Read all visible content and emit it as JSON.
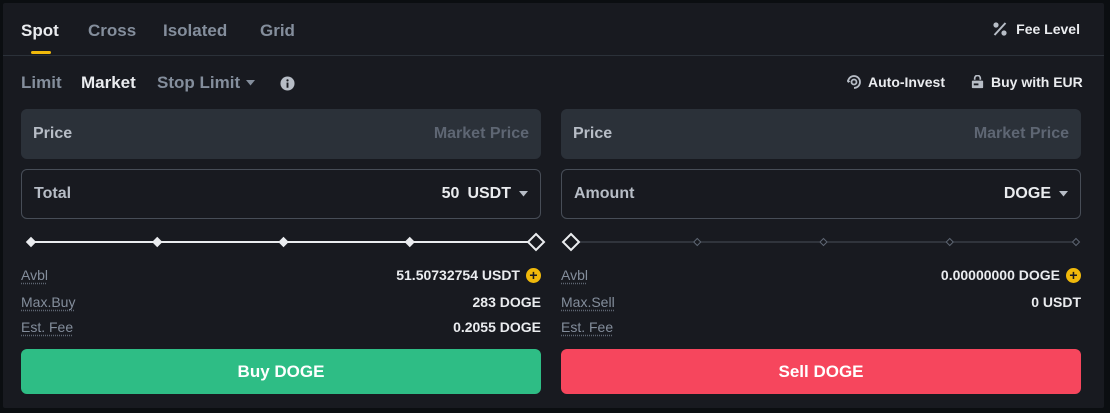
{
  "top_tabs": [
    {
      "label": "Spot",
      "active": true
    },
    {
      "label": "Cross",
      "active": false
    },
    {
      "label": "Isolated",
      "active": false
    },
    {
      "label": "Grid",
      "active": false
    }
  ],
  "fee_level": {
    "label": "Fee Level",
    "icon": "percent-icon"
  },
  "order_types": [
    {
      "label": "Limit",
      "active": false
    },
    {
      "label": "Market",
      "active": true
    },
    {
      "label": "Stop Limit",
      "active": false
    }
  ],
  "links": {
    "auto_invest": "Auto-Invest",
    "buy_with_eur": "Buy with EUR"
  },
  "buy": {
    "price_label": "Price",
    "price_placeholder": "Market Price",
    "total_label": "Total",
    "total_value": "50",
    "total_unit": "USDT",
    "slider_fraction": 1.0,
    "avbl_label": "Avbl",
    "avbl_value": "51.50732754 USDT",
    "max_label": "Max.Buy",
    "max_value": "283 DOGE",
    "fee_label": "Est. Fee",
    "fee_value": "0.2055 DOGE",
    "button": "Buy DOGE"
  },
  "sell": {
    "price_label": "Price",
    "price_placeholder": "Market Price",
    "amount_label": "Amount",
    "amount_unit": "DOGE",
    "slider_fraction": 0.0,
    "avbl_label": "Avbl",
    "avbl_value": "0.00000000 DOGE",
    "max_label": "Max.Sell",
    "max_value": "0 USDT",
    "fee_label": "Est. Fee",
    "button": "Sell DOGE"
  },
  "colors": {
    "buy": "#2ebd85",
    "sell": "#f6465d",
    "accent": "#f0b90b"
  }
}
